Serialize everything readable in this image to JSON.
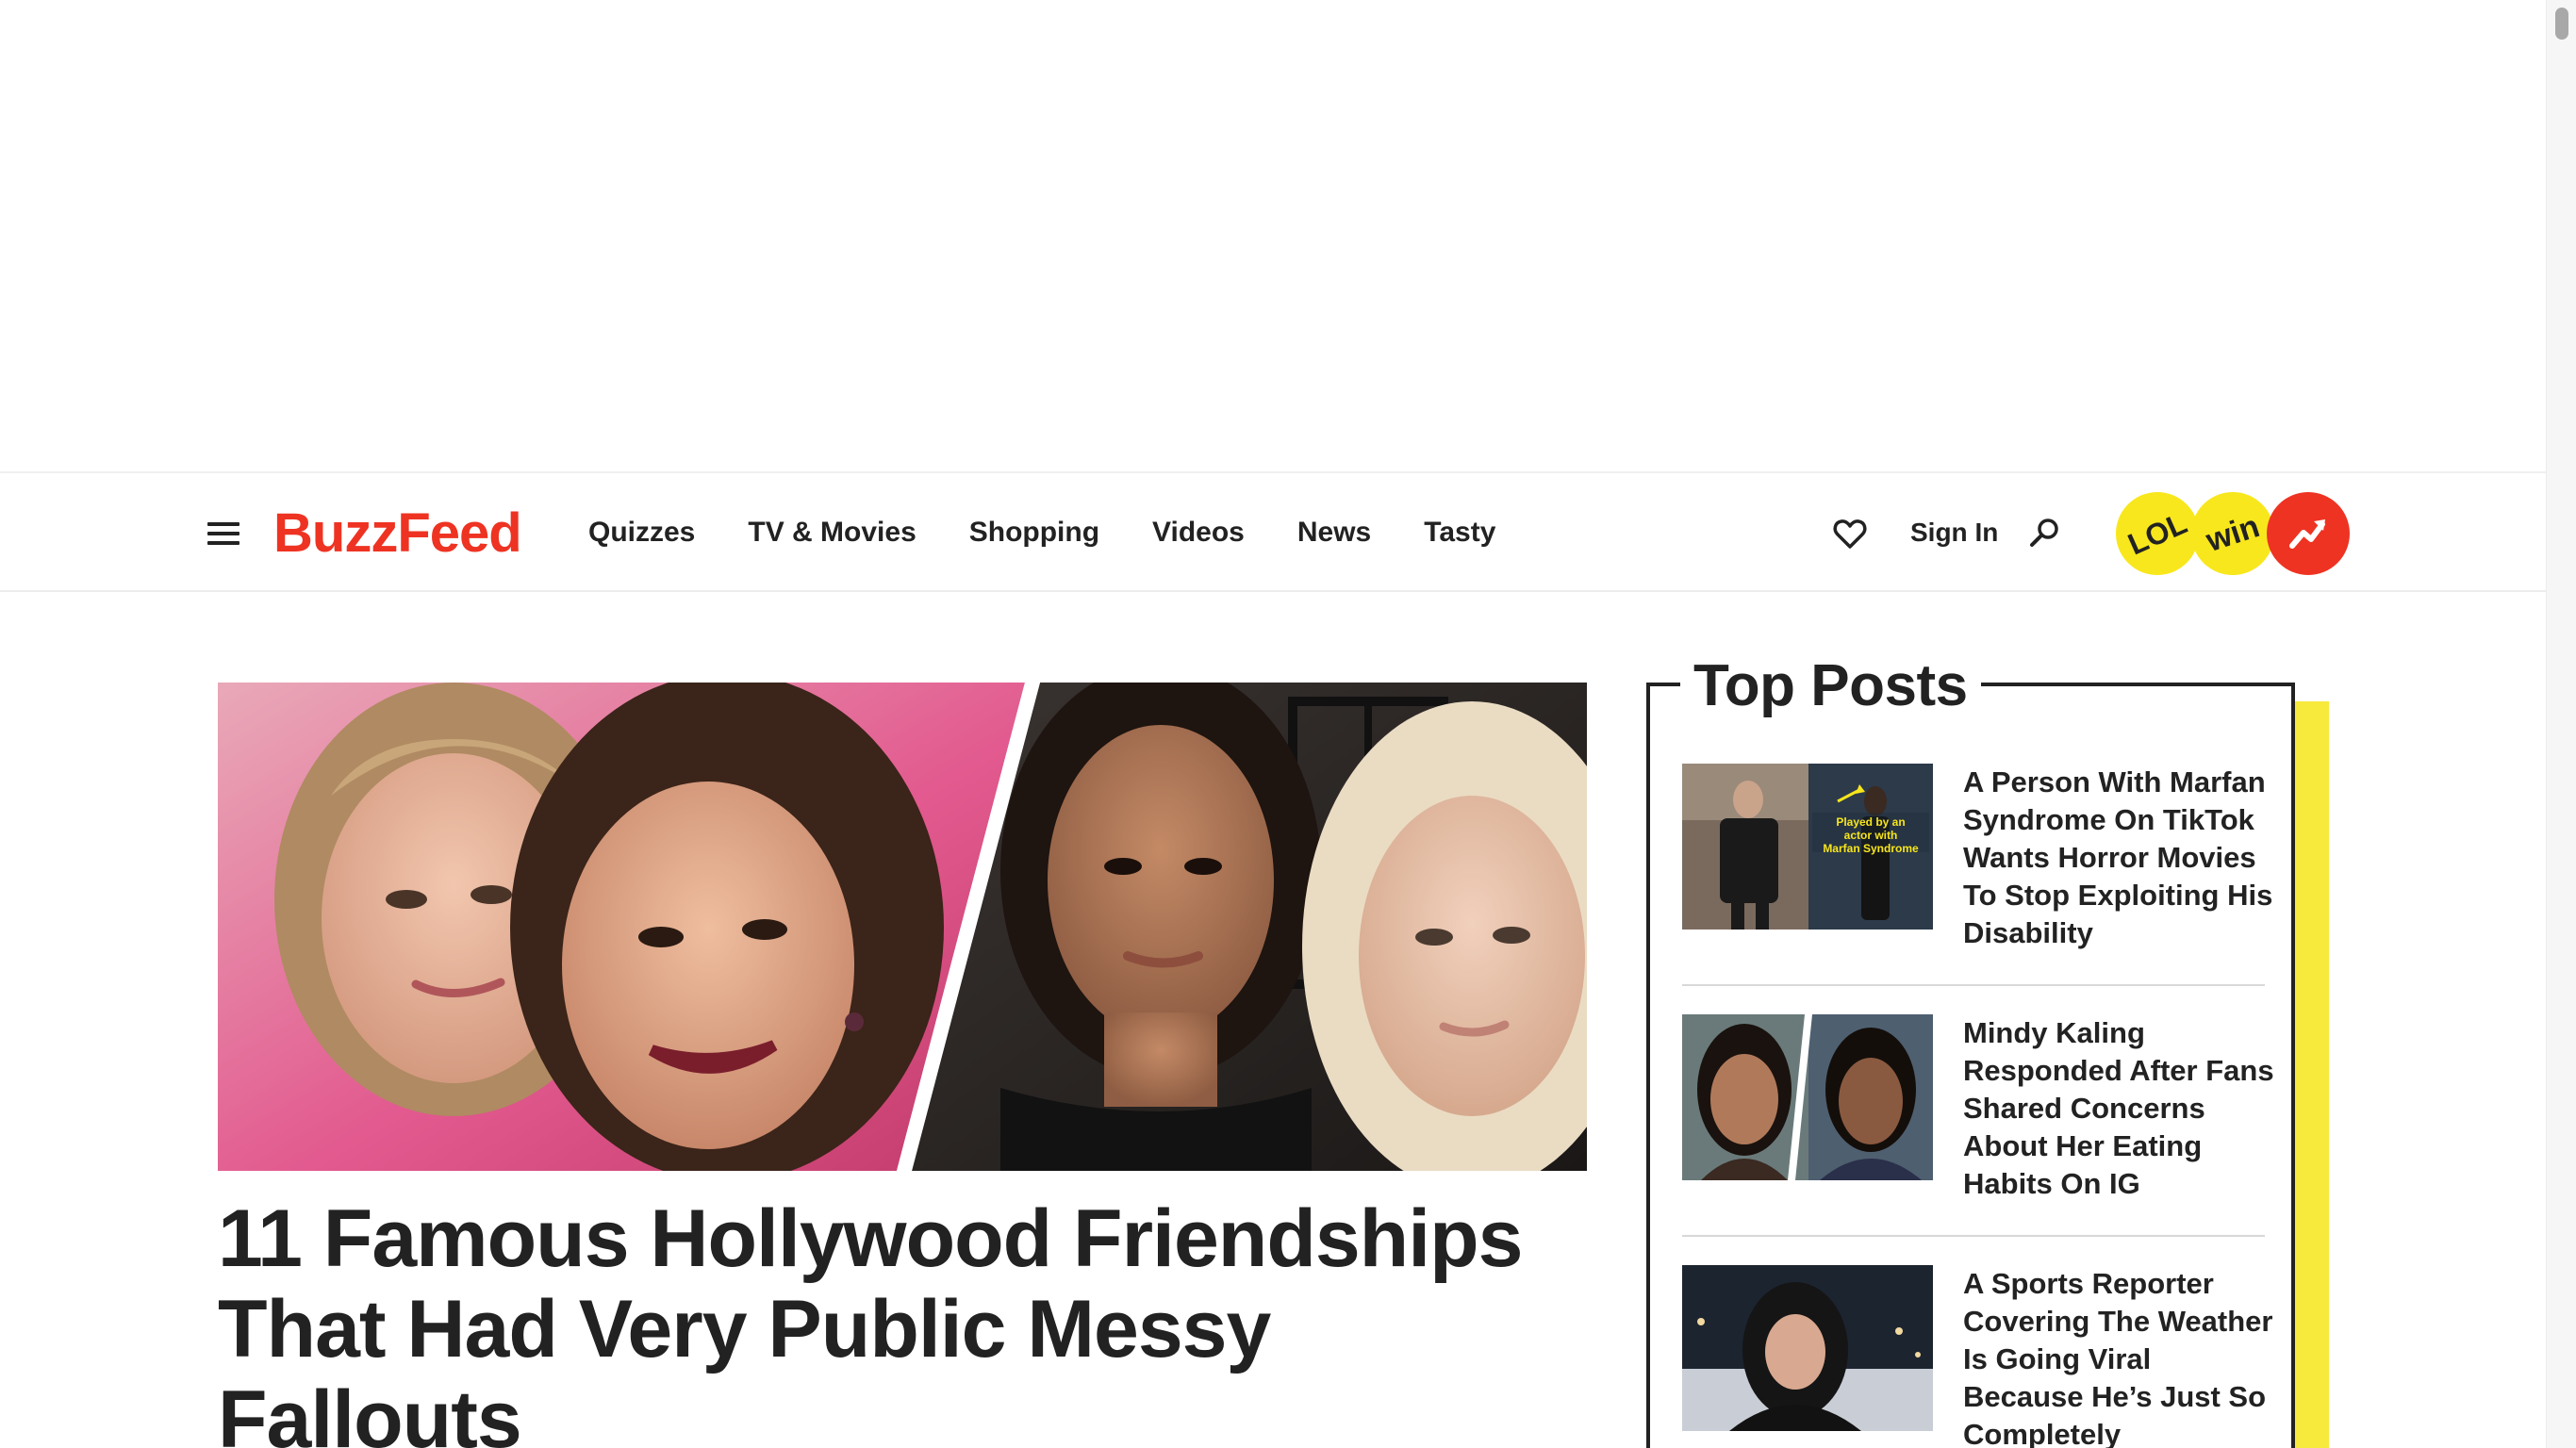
{
  "header": {
    "logo": "BuzzFeed",
    "nav": [
      "Quizzes",
      "TV & Movies",
      "Shopping",
      "Videos",
      "News",
      "Tasty"
    ],
    "sign_in": "Sign In",
    "badges": {
      "lol": "LOL",
      "win": "win"
    }
  },
  "article": {
    "headline": "11 Famous Hollywood Friendships That Had Very Public Messy Fallouts"
  },
  "top_posts": {
    "title": "Top Posts",
    "items": [
      {
        "title": "A Person With Marfan Syndrome On TikTok Wants Horror Movies To Stop Exploiting His Disability",
        "thumb_caption": "Played by an actor with Marfan Syndrome"
      },
      {
        "title": "Mindy Kaling Responded After Fans Shared Concerns About Her Eating Habits On IG"
      },
      {
        "title": "A Sports Reporter Covering The Weather Is Going Viral Because He’s Just So Completely"
      }
    ]
  },
  "colors": {
    "brand": "#ee3322",
    "badge_yellow": "#f8e71c",
    "accent_yellow": "#f7ea3c"
  }
}
